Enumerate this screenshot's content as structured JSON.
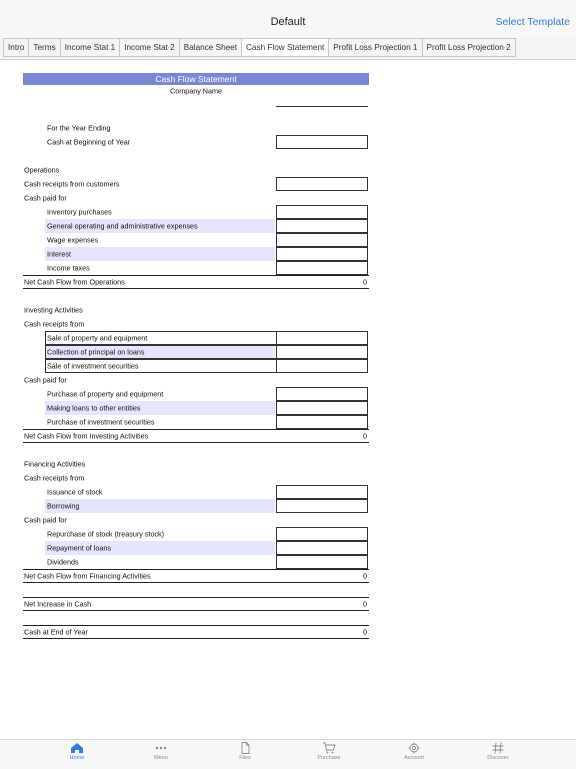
{
  "nav": {
    "title": "Default",
    "right_action": "Select Template"
  },
  "tabs": [
    "Intro",
    "Terms",
    "Income Stat 1",
    "Income Stat 2",
    "Balance Sheet",
    "Cash Flow Statement",
    "Profit Loss Projection 1",
    "Profit Loss Projection 2"
  ],
  "active_tab": 5,
  "sheet": {
    "banner": "Cash Flow Statement",
    "rows": [
      {
        "text": "Company Name",
        "type": "center-under"
      },
      {
        "text": "",
        "type": "blank"
      },
      {
        "text": "For the Year Ending",
        "type": "label",
        "indent": 1
      },
      {
        "text": "Cash at Beginning of Year",
        "type": "input",
        "indent": 1
      },
      {
        "text": "",
        "type": "blank"
      },
      {
        "text": "Operations",
        "type": "label",
        "indent": 0
      },
      {
        "text": "Cash receipts from customers",
        "type": "input",
        "indent": 0
      },
      {
        "text": "Cash paid for",
        "type": "label",
        "indent": 0
      },
      {
        "text": "Inventory purchases",
        "type": "input",
        "indent": 1
      },
      {
        "text": "General operating and administrative expenses",
        "type": "input",
        "indent": 1,
        "shade": true
      },
      {
        "text": "Wage expenses",
        "type": "input",
        "indent": 1
      },
      {
        "text": "Interest",
        "type": "input",
        "indent": 1,
        "shade": true
      },
      {
        "text": "Income taxes",
        "type": "input",
        "indent": 1
      },
      {
        "text": "Net Cash Flow from Operations",
        "type": "total",
        "value": "0"
      },
      {
        "text": "",
        "type": "blank"
      },
      {
        "text": "Investing Activities",
        "type": "label",
        "indent": 0
      },
      {
        "text": "Cash receipts from",
        "type": "label",
        "indent": 0
      },
      {
        "text": "Sale of property and equipment",
        "type": "input-boxed",
        "indent": 1
      },
      {
        "text": "Collection of principal on loans",
        "type": "input-boxed",
        "indent": 1,
        "shade": true
      },
      {
        "text": "Sale of investment securities",
        "type": "input-boxed",
        "indent": 1
      },
      {
        "text": "Cash paid for",
        "type": "label",
        "indent": 0
      },
      {
        "text": "Purchase of property and equipment",
        "type": "input",
        "indent": 1
      },
      {
        "text": "Making loans to other entities",
        "type": "input",
        "indent": 1,
        "shade": true
      },
      {
        "text": "Purchase of investment securities",
        "type": "input",
        "indent": 1
      },
      {
        "text": "Net Cash Flow from Investing Activities",
        "type": "total",
        "value": "0"
      },
      {
        "text": "",
        "type": "blank"
      },
      {
        "text": "Financing Activities",
        "type": "label",
        "indent": 0
      },
      {
        "text": "Cash receipts from",
        "type": "label",
        "indent": 0
      },
      {
        "text": "Issuance of stock",
        "type": "input",
        "indent": 1
      },
      {
        "text": "Borrowing",
        "type": "input",
        "indent": 1,
        "shade": true
      },
      {
        "text": "Cash paid for",
        "type": "label",
        "indent": 0
      },
      {
        "text": "Repurchase of stock (treasury stock)",
        "type": "input",
        "indent": 1
      },
      {
        "text": "Repayment of loans",
        "type": "input",
        "indent": 1,
        "shade": true
      },
      {
        "text": "Dividends",
        "type": "input",
        "indent": 1
      },
      {
        "text": "Net Cash Flow from Financing Activities",
        "type": "total",
        "value": "0"
      },
      {
        "text": "",
        "type": "blank"
      },
      {
        "text": "Net Increase in Cash",
        "type": "total",
        "value": "0"
      },
      {
        "text": "",
        "type": "blank"
      },
      {
        "text": "Cash at End of Year",
        "type": "total",
        "value": "0"
      }
    ]
  },
  "bottom_tabs": [
    {
      "label": "Home",
      "icon": "home-icon"
    },
    {
      "label": "Menu",
      "icon": "dots-icon"
    },
    {
      "label": "Files",
      "icon": "file-icon"
    },
    {
      "label": "Purchase",
      "icon": "cart-icon"
    },
    {
      "label": "Account",
      "icon": "gear-icon"
    },
    {
      "label": "Discover",
      "icon": "hash-icon"
    }
  ],
  "active_bottom": 0,
  "colors": {
    "accent": "#3a7be0",
    "banner": "#7b86d8",
    "shade": "#e5e6fb"
  }
}
